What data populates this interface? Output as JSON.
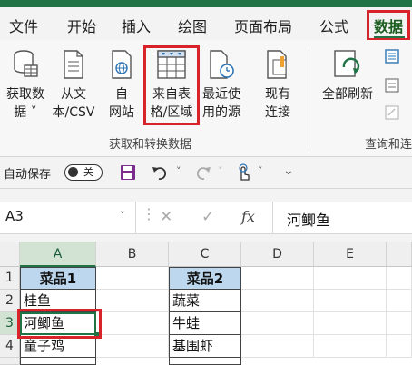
{
  "tabs": [
    "文件",
    "开始",
    "插入",
    "绘图",
    "页面布局",
    "公式",
    "数据"
  ],
  "ribbon": {
    "get_data": {
      "line1": "获取数",
      "line2": "据 ˅"
    },
    "from_text": {
      "line1": "从文",
      "line2": "本/CSV"
    },
    "from_web": {
      "line1": "自",
      "line2": "网站"
    },
    "from_table": {
      "line1": "来自表",
      "line2": "格/区域"
    },
    "recent": {
      "line1": "最近使",
      "line2": "用的源"
    },
    "existing": {
      "line1": "现有",
      "line2": "连接"
    },
    "refresh_all": {
      "line1": "全部刷新"
    },
    "group1_label": "获取和转换数据",
    "group2_label": "查询和连"
  },
  "qat": {
    "autosave_label": "自动保存",
    "toggle_text": "关"
  },
  "formula_bar": {
    "name_box": "A3",
    "cancel": "✕",
    "enter": "✓",
    "fx": "fx",
    "content": "河鲫鱼"
  },
  "grid": {
    "columns": [
      "A",
      "B",
      "C",
      "D",
      "E"
    ],
    "rows": [
      "1",
      "2",
      "3",
      "4"
    ],
    "A": [
      "菜品1",
      "桂鱼",
      "河鲫鱼",
      "童子鸡"
    ],
    "C": [
      "菜品2",
      "蔬菜",
      "牛蛙",
      "基围虾"
    ]
  }
}
